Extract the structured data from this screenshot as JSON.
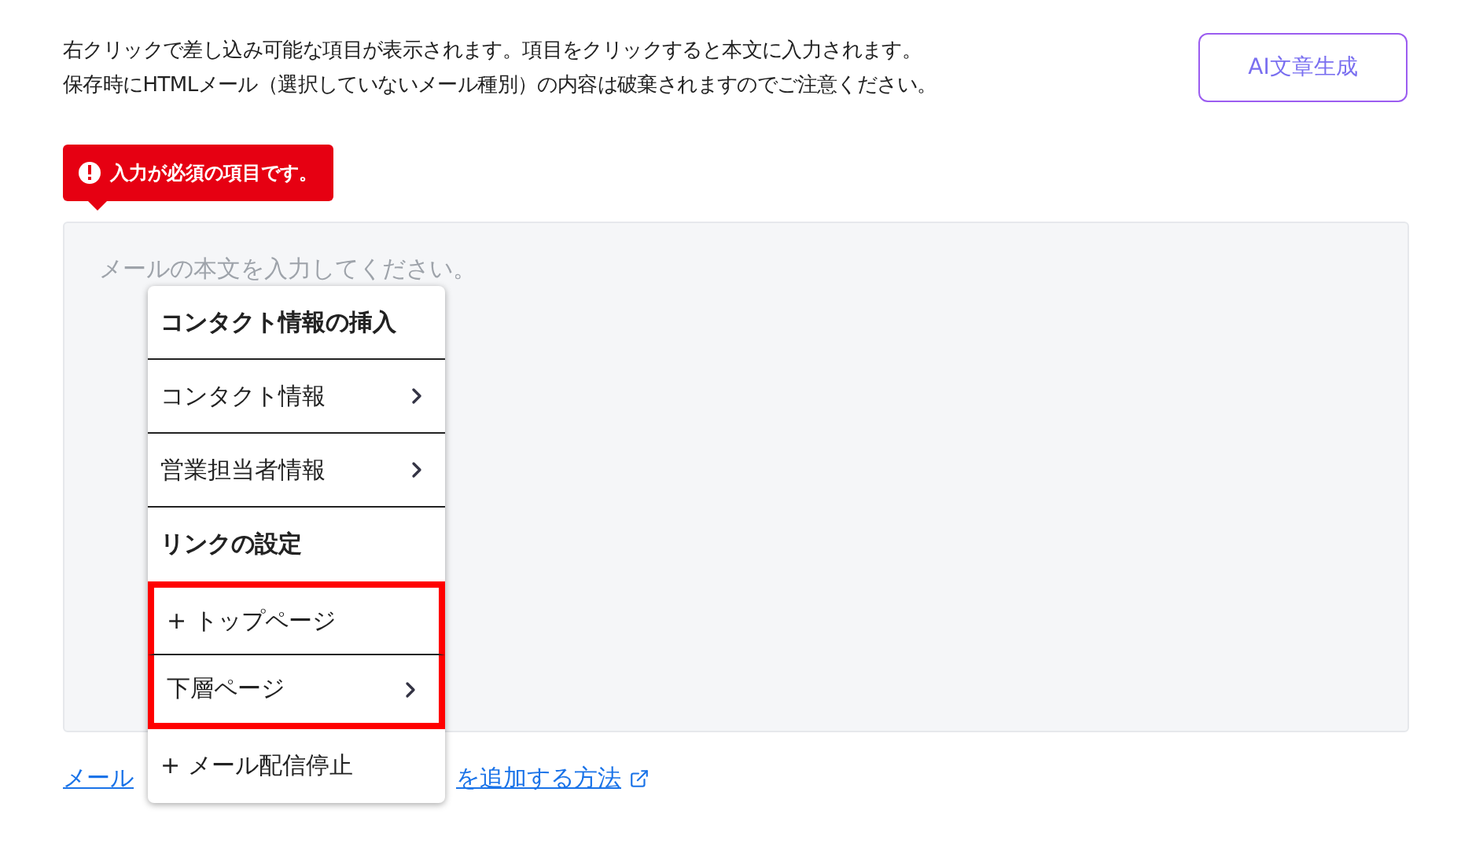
{
  "notes": [
    "右クリックで差し込み可能な項目が表示されます。項目をクリックすると本文に入力されます。",
    "保存時にHTMLメール（選択していないメール種別）の内容は破棄されますのでご注意ください。"
  ],
  "ai_button": {
    "label": "AI文章生成"
  },
  "error_tooltip": {
    "text": "入力が必須の項目です。"
  },
  "body_field": {
    "placeholder": "メールの本文を入力してください。"
  },
  "context_menu": {
    "items": [
      {
        "kind": "header",
        "label": "コンタクト情報の挿入",
        "highlighted": false
      },
      {
        "kind": "submenu",
        "label": "コンタクト情報",
        "highlighted": false
      },
      {
        "kind": "submenu",
        "label": "営業担当者情報",
        "highlighted": false
      },
      {
        "kind": "header",
        "label": "リンクの設定",
        "highlighted": false
      },
      {
        "kind": "action",
        "label": "+ トップページ",
        "highlighted": true
      },
      {
        "kind": "submenu",
        "label": "下層ページ",
        "highlighted": true
      },
      {
        "kind": "action",
        "label": "+ メール配信停止",
        "highlighted": false
      }
    ]
  },
  "help_link": {
    "visible_start": "メール",
    "visible_end": "を追加する方法"
  }
}
